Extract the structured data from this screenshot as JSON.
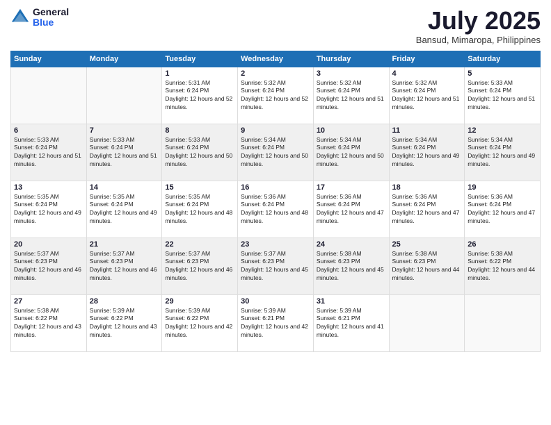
{
  "logo": {
    "general": "General",
    "blue": "Blue"
  },
  "title": "July 2025",
  "subtitle": "Bansud, Mimaropa, Philippines",
  "days_of_week": [
    "Sunday",
    "Monday",
    "Tuesday",
    "Wednesday",
    "Thursday",
    "Friday",
    "Saturday"
  ],
  "weeks": [
    [
      {
        "day": "",
        "sunrise": "",
        "sunset": "",
        "daylight": ""
      },
      {
        "day": "",
        "sunrise": "",
        "sunset": "",
        "daylight": ""
      },
      {
        "day": "1",
        "sunrise": "Sunrise: 5:31 AM",
        "sunset": "Sunset: 6:24 PM",
        "daylight": "Daylight: 12 hours and 52 minutes."
      },
      {
        "day": "2",
        "sunrise": "Sunrise: 5:32 AM",
        "sunset": "Sunset: 6:24 PM",
        "daylight": "Daylight: 12 hours and 52 minutes."
      },
      {
        "day": "3",
        "sunrise": "Sunrise: 5:32 AM",
        "sunset": "Sunset: 6:24 PM",
        "daylight": "Daylight: 12 hours and 51 minutes."
      },
      {
        "day": "4",
        "sunrise": "Sunrise: 5:32 AM",
        "sunset": "Sunset: 6:24 PM",
        "daylight": "Daylight: 12 hours and 51 minutes."
      },
      {
        "day": "5",
        "sunrise": "Sunrise: 5:33 AM",
        "sunset": "Sunset: 6:24 PM",
        "daylight": "Daylight: 12 hours and 51 minutes."
      }
    ],
    [
      {
        "day": "6",
        "sunrise": "Sunrise: 5:33 AM",
        "sunset": "Sunset: 6:24 PM",
        "daylight": "Daylight: 12 hours and 51 minutes."
      },
      {
        "day": "7",
        "sunrise": "Sunrise: 5:33 AM",
        "sunset": "Sunset: 6:24 PM",
        "daylight": "Daylight: 12 hours and 51 minutes."
      },
      {
        "day": "8",
        "sunrise": "Sunrise: 5:33 AM",
        "sunset": "Sunset: 6:24 PM",
        "daylight": "Daylight: 12 hours and 50 minutes."
      },
      {
        "day": "9",
        "sunrise": "Sunrise: 5:34 AM",
        "sunset": "Sunset: 6:24 PM",
        "daylight": "Daylight: 12 hours and 50 minutes."
      },
      {
        "day": "10",
        "sunrise": "Sunrise: 5:34 AM",
        "sunset": "Sunset: 6:24 PM",
        "daylight": "Daylight: 12 hours and 50 minutes."
      },
      {
        "day": "11",
        "sunrise": "Sunrise: 5:34 AM",
        "sunset": "Sunset: 6:24 PM",
        "daylight": "Daylight: 12 hours and 49 minutes."
      },
      {
        "day": "12",
        "sunrise": "Sunrise: 5:34 AM",
        "sunset": "Sunset: 6:24 PM",
        "daylight": "Daylight: 12 hours and 49 minutes."
      }
    ],
    [
      {
        "day": "13",
        "sunrise": "Sunrise: 5:35 AM",
        "sunset": "Sunset: 6:24 PM",
        "daylight": "Daylight: 12 hours and 49 minutes."
      },
      {
        "day": "14",
        "sunrise": "Sunrise: 5:35 AM",
        "sunset": "Sunset: 6:24 PM",
        "daylight": "Daylight: 12 hours and 49 minutes."
      },
      {
        "day": "15",
        "sunrise": "Sunrise: 5:35 AM",
        "sunset": "Sunset: 6:24 PM",
        "daylight": "Daylight: 12 hours and 48 minutes."
      },
      {
        "day": "16",
        "sunrise": "Sunrise: 5:36 AM",
        "sunset": "Sunset: 6:24 PM",
        "daylight": "Daylight: 12 hours and 48 minutes."
      },
      {
        "day": "17",
        "sunrise": "Sunrise: 5:36 AM",
        "sunset": "Sunset: 6:24 PM",
        "daylight": "Daylight: 12 hours and 47 minutes."
      },
      {
        "day": "18",
        "sunrise": "Sunrise: 5:36 AM",
        "sunset": "Sunset: 6:24 PM",
        "daylight": "Daylight: 12 hours and 47 minutes."
      },
      {
        "day": "19",
        "sunrise": "Sunrise: 5:36 AM",
        "sunset": "Sunset: 6:24 PM",
        "daylight": "Daylight: 12 hours and 47 minutes."
      }
    ],
    [
      {
        "day": "20",
        "sunrise": "Sunrise: 5:37 AM",
        "sunset": "Sunset: 6:23 PM",
        "daylight": "Daylight: 12 hours and 46 minutes."
      },
      {
        "day": "21",
        "sunrise": "Sunrise: 5:37 AM",
        "sunset": "Sunset: 6:23 PM",
        "daylight": "Daylight: 12 hours and 46 minutes."
      },
      {
        "day": "22",
        "sunrise": "Sunrise: 5:37 AM",
        "sunset": "Sunset: 6:23 PM",
        "daylight": "Daylight: 12 hours and 46 minutes."
      },
      {
        "day": "23",
        "sunrise": "Sunrise: 5:37 AM",
        "sunset": "Sunset: 6:23 PM",
        "daylight": "Daylight: 12 hours and 45 minutes."
      },
      {
        "day": "24",
        "sunrise": "Sunrise: 5:38 AM",
        "sunset": "Sunset: 6:23 PM",
        "daylight": "Daylight: 12 hours and 45 minutes."
      },
      {
        "day": "25",
        "sunrise": "Sunrise: 5:38 AM",
        "sunset": "Sunset: 6:23 PM",
        "daylight": "Daylight: 12 hours and 44 minutes."
      },
      {
        "day": "26",
        "sunrise": "Sunrise: 5:38 AM",
        "sunset": "Sunset: 6:22 PM",
        "daylight": "Daylight: 12 hours and 44 minutes."
      }
    ],
    [
      {
        "day": "27",
        "sunrise": "Sunrise: 5:38 AM",
        "sunset": "Sunset: 6:22 PM",
        "daylight": "Daylight: 12 hours and 43 minutes."
      },
      {
        "day": "28",
        "sunrise": "Sunrise: 5:39 AM",
        "sunset": "Sunset: 6:22 PM",
        "daylight": "Daylight: 12 hours and 43 minutes."
      },
      {
        "day": "29",
        "sunrise": "Sunrise: 5:39 AM",
        "sunset": "Sunset: 6:22 PM",
        "daylight": "Daylight: 12 hours and 42 minutes."
      },
      {
        "day": "30",
        "sunrise": "Sunrise: 5:39 AM",
        "sunset": "Sunset: 6:21 PM",
        "daylight": "Daylight: 12 hours and 42 minutes."
      },
      {
        "day": "31",
        "sunrise": "Sunrise: 5:39 AM",
        "sunset": "Sunset: 6:21 PM",
        "daylight": "Daylight: 12 hours and 41 minutes."
      },
      {
        "day": "",
        "sunrise": "",
        "sunset": "",
        "daylight": ""
      },
      {
        "day": "",
        "sunrise": "",
        "sunset": "",
        "daylight": ""
      }
    ]
  ]
}
